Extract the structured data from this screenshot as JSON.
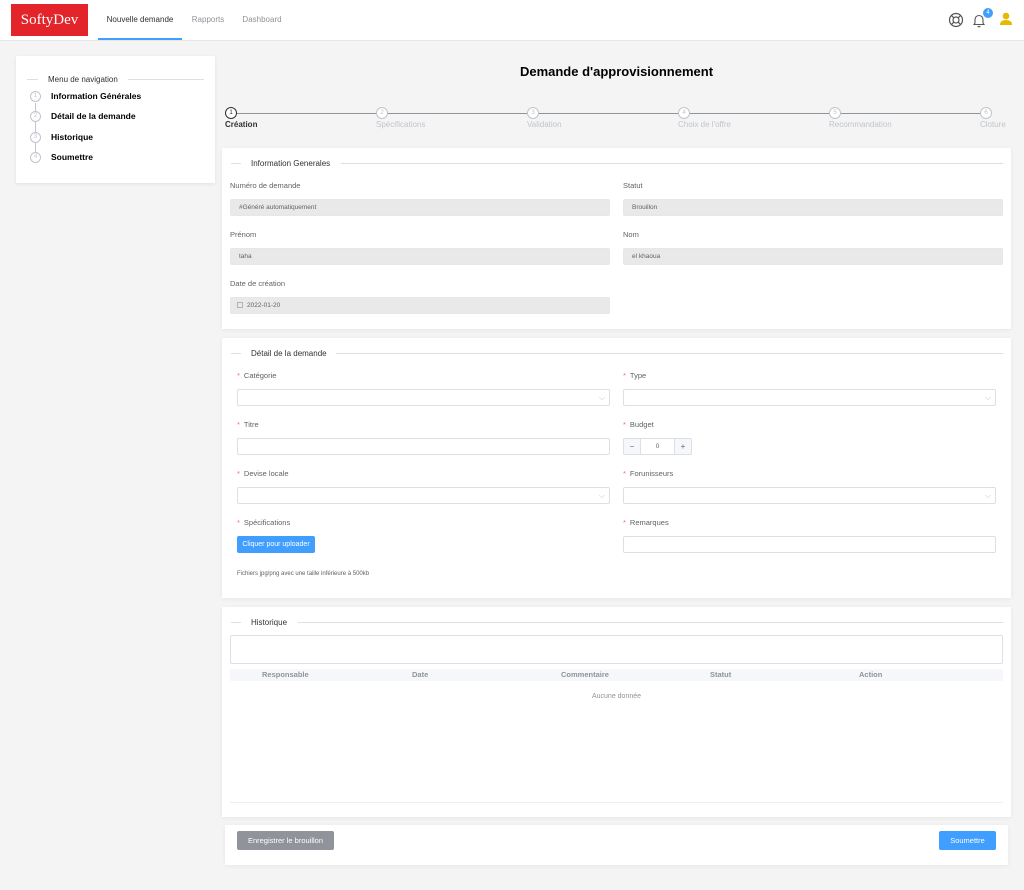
{
  "header": {
    "logo": "SoftyDev",
    "nav": [
      {
        "label": "Nouvelle demande",
        "active": true
      },
      {
        "label": "Rapports",
        "active": false
      },
      {
        "label": "Dashboard",
        "active": false
      }
    ],
    "notifications_count": "4",
    "icons": [
      "help-icon",
      "bell-icon",
      "user-icon"
    ]
  },
  "sidebar": {
    "title": "Menu de navigation",
    "items": [
      {
        "num": "1",
        "label": "Information Générales"
      },
      {
        "num": "2",
        "label": "Détail de la demande"
      },
      {
        "num": "3",
        "label": "Historique"
      },
      {
        "num": "4",
        "label": "Soumettre"
      }
    ]
  },
  "page": {
    "title": "Demande d'approvisionnement"
  },
  "steps": [
    {
      "num": "1",
      "label": "Création",
      "active": true
    },
    {
      "num": "2",
      "label": "Spécifications",
      "active": false
    },
    {
      "num": "3",
      "label": "Validation",
      "active": false
    },
    {
      "num": "4",
      "label": "Choix de l'offre",
      "active": false
    },
    {
      "num": "5",
      "label": "Recommandation",
      "active": false
    },
    {
      "num": "6",
      "label": "Cloture",
      "active": false
    }
  ],
  "info": {
    "title": "Information Generales",
    "numero_label": "Numéro de demande",
    "numero_value": "#Généré automatiquement",
    "statut_label": "Statut",
    "statut_value": "Brouillon",
    "prenom_label": "Prénom",
    "prenom_value": "taha",
    "nom_label": "Nom",
    "nom_value": "el khaoua",
    "date_label": "Date de création",
    "date_value": "2022-01-20"
  },
  "detail": {
    "title": "Détail de la demande",
    "required_mark": "*",
    "categorie_label": "Catégorie",
    "type_label": "Type",
    "titre_label": "Titre",
    "budget_label": "Budget",
    "budget_value": "0",
    "budget_minus": "−",
    "budget_plus": "+",
    "devise_label": "Devise locale",
    "fournisseurs_label": "Forunisseurs",
    "specs_label": "Spécifications",
    "upload_button": "Cliquer pour uploader",
    "remarques_label": "Remarques",
    "upload_hint": "Fichiers jpg/png avec une taille inférieure à 500kb"
  },
  "historique": {
    "title": "Historique",
    "columns": [
      "Responsable",
      "Date",
      "Commentaire",
      "Statut",
      "Action"
    ],
    "empty_text": "Aucune donnée"
  },
  "footer": {
    "save_draft": "Enregistrer le brouillon",
    "submit": "Soumettre"
  },
  "colors": {
    "brand": "#e3242b",
    "primary": "#409eff",
    "required": "#f56c6c",
    "user_icon": "#e6b800"
  }
}
